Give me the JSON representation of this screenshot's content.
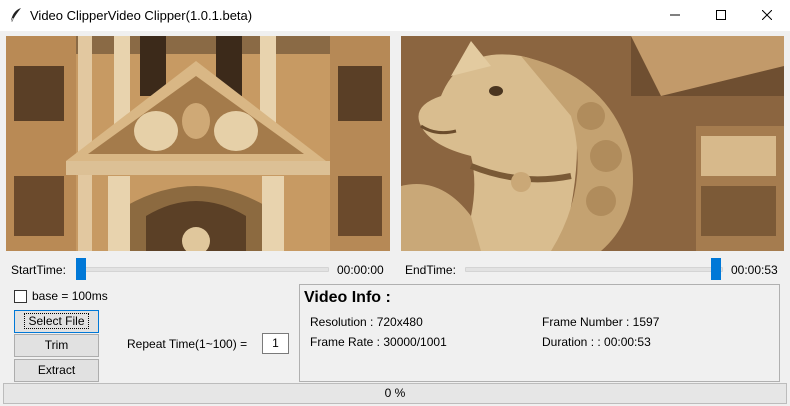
{
  "window": {
    "title": "Video ClipperVideo Clipper(1.0.1.beta)",
    "icons": {
      "app": "feather-icon",
      "minimize": "minimize-icon",
      "maximize": "maximize-icon",
      "close": "close-icon"
    }
  },
  "preview": {
    "start_frame_desc": "building-facade-sculpture",
    "end_frame_desc": "horse-statue-sculpture"
  },
  "start": {
    "label": "StartTime:",
    "time": "00:00:00",
    "position_fraction": 0.0
  },
  "end": {
    "label": "EndTime:",
    "time": "00:00:53",
    "position_fraction": 1.0
  },
  "options": {
    "base_label": "base = 100ms",
    "base_checked": false
  },
  "buttons": {
    "select_file": "Select File",
    "trim": "Trim",
    "extract": "Extract"
  },
  "repeat": {
    "label": "Repeat Time(1~100) =",
    "value": "1"
  },
  "info": {
    "title": "Video Info :",
    "resolution": "Resolution : 720x480",
    "frame_rate": "Frame Rate : 30000/1001",
    "frame_number": "Frame Number : 1597",
    "duration": "Duration : : 00:00:53"
  },
  "progress": {
    "text": "0 %",
    "fraction": 0.0
  },
  "colors": {
    "accent": "#0078d7",
    "background": "#f0f0f0"
  }
}
